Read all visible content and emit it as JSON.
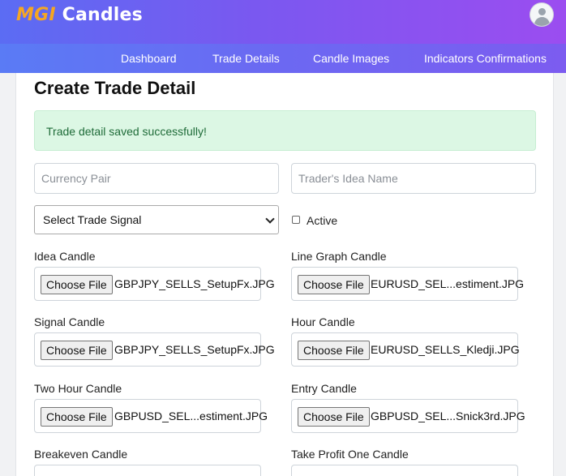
{
  "header": {
    "logo_part1": "MGI",
    "logo_part2": "Candles"
  },
  "nav": {
    "items": [
      "Dashboard",
      "Trade Details",
      "Candle Images",
      "Indicators Confirmations"
    ]
  },
  "page": {
    "title": "Create Trade Detail"
  },
  "alert": {
    "message": "Trade detail saved successfully!"
  },
  "form": {
    "currency_pair_placeholder": "Currency Pair",
    "idea_name_placeholder": "Trader's Idea Name",
    "trade_signal_selected": "Select Trade Signal",
    "active_label": "Active",
    "active_checked": false,
    "choose_file_label": "Choose File",
    "files": [
      {
        "label": "Idea Candle",
        "filename": "GBPJPY_SELLS_SetupFx.JPG"
      },
      {
        "label": "Line Graph Candle",
        "filename": "EURUSD_SEL...estiment.JPG"
      },
      {
        "label": "Signal Candle",
        "filename": "GBPJPY_SELLS_SetupFx.JPG"
      },
      {
        "label": "Hour Candle",
        "filename": "EURUSD_SELLS_Kledji.JPG"
      },
      {
        "label": "Two Hour Candle",
        "filename": "GBPUSD_SEL...estiment.JPG"
      },
      {
        "label": "Entry Candle",
        "filename": "GBPUSD_SEL...Snick3rd.JPG"
      },
      {
        "label": "Breakeven Candle",
        "filename": ""
      },
      {
        "label": "Take Profit One Candle",
        "filename": ""
      }
    ]
  },
  "colors": {
    "alert_bg": "#dcf7e4",
    "alert_text": "#1e6b38",
    "logo_accent": "#f5a623",
    "header_gradient_start": "#5b6cf3",
    "header_gradient_end": "#9b4df0"
  }
}
